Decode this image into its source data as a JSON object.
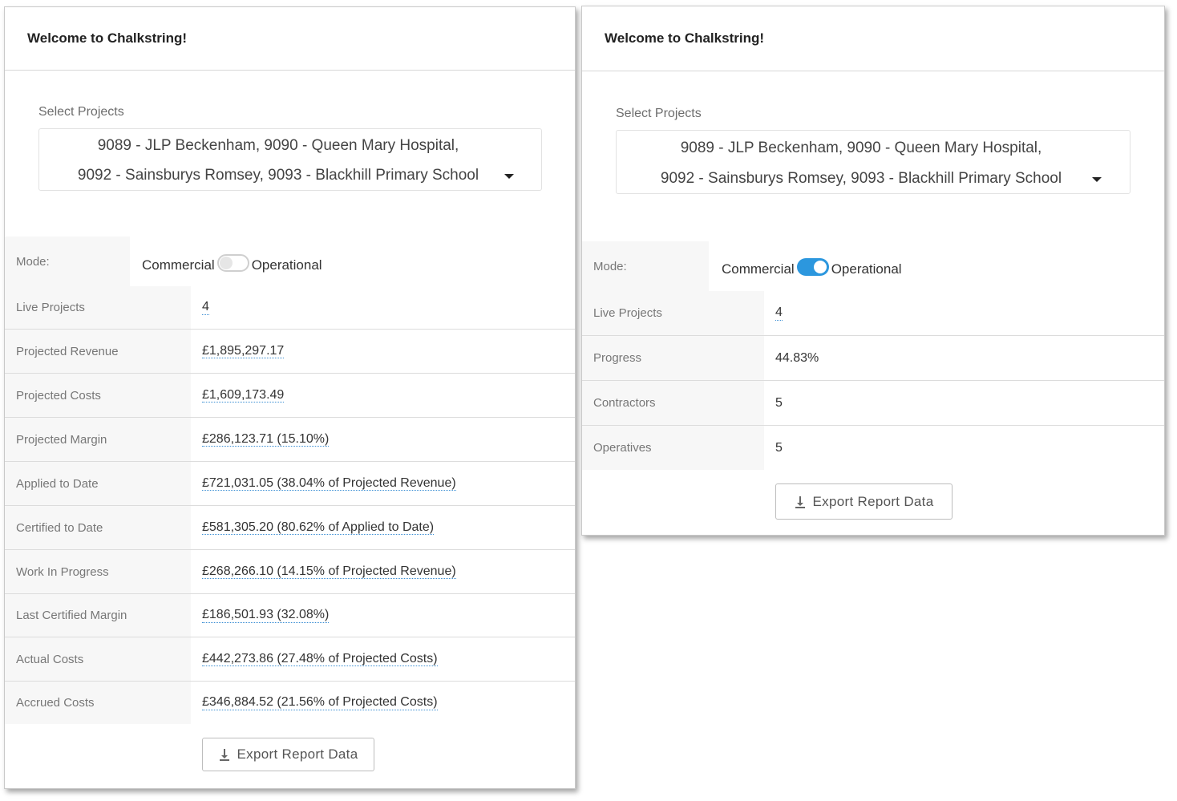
{
  "left_panel": {
    "title": "Welcome to Chalkstring!",
    "select_label": "Select Projects",
    "selected_line1": "9089 - JLP Beckenham,  9090 - Queen Mary Hospital,",
    "selected_line2": "9092 - Sainsburys Romsey,  9093 - Blackhill Primary School",
    "mode_label": "Mode:",
    "mode_option_left": "Commercial",
    "mode_option_right": "Operational",
    "mode_toggle_on": false,
    "rows": [
      {
        "label": "Live Projects",
        "value": "4"
      },
      {
        "label": "Projected Revenue",
        "value": "£1,895,297.17"
      },
      {
        "label": "Projected Costs",
        "value": "£1,609,173.49"
      },
      {
        "label": "Projected Margin",
        "value": "£286,123.71 (15.10%)"
      },
      {
        "label": "Applied to Date",
        "value": "£721,031.05 (38.04% of Projected Revenue)"
      },
      {
        "label": "Certified to Date",
        "value": "£581,305.20 (80.62% of Applied to Date)"
      },
      {
        "label": "Work In Progress",
        "value": "£268,266.10 (14.15% of Projected Revenue)"
      },
      {
        "label": "Last Certified Margin",
        "value": "£186,501.93 (32.08%)"
      },
      {
        "label": "Actual Costs",
        "value": "£442,273.86 (27.48% of Projected Costs)"
      },
      {
        "label": "Accrued Costs",
        "value": "£346,884.52 (21.56% of Projected Costs)"
      }
    ],
    "export_label": "Export Report Data"
  },
  "right_panel": {
    "title": "Welcome to Chalkstring!",
    "select_label": "Select Projects",
    "selected_line1": "9089 - JLP Beckenham,  9090 - Queen Mary Hospital,",
    "selected_line2": "9092 - Sainsburys Romsey,  9093 - Blackhill Primary School",
    "mode_label": "Mode:",
    "mode_option_left": "Commercial",
    "mode_option_right": "Operational",
    "mode_toggle_on": true,
    "rows": [
      {
        "label": "Live Projects",
        "value": "4"
      },
      {
        "label": "Progress",
        "value": "44.83%"
      },
      {
        "label": "Contractors",
        "value": "5"
      },
      {
        "label": "Operatives",
        "value": "5"
      }
    ],
    "export_label": "Export Report Data"
  },
  "colors": {
    "toggle_on": "#2c97de",
    "label_cell_bg": "#f7f7f7",
    "link_underline": "#3b8ed3"
  },
  "icons": {
    "dropdown": "caret-down-icon",
    "export": "download-icon"
  }
}
